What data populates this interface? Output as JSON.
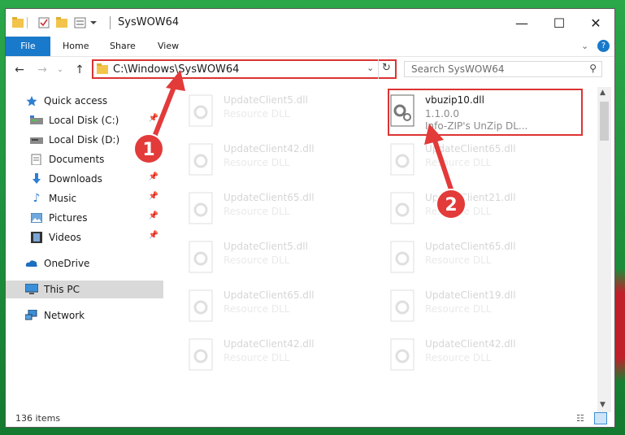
{
  "window": {
    "title": "SysWOW64",
    "controls": {
      "minimize": "—",
      "maximize": "☐",
      "close": "✕"
    }
  },
  "ribbon": {
    "tabs": [
      {
        "label": "File"
      },
      {
        "label": "Home"
      },
      {
        "label": "Share"
      },
      {
        "label": "View"
      }
    ],
    "help": "?"
  },
  "address": {
    "path": "C:\\Windows\\SysWOW64",
    "search_placeholder": "Search SysWOW64"
  },
  "sidebar": {
    "items": [
      {
        "label": "Quick access",
        "icon": "star-icon",
        "pinned": false
      },
      {
        "label": "Local Disk (C:)",
        "icon": "drive-icon",
        "pinned": true
      },
      {
        "label": "Local Disk (D:)",
        "icon": "drive-icon",
        "pinned": true
      },
      {
        "label": "Documents",
        "icon": "documents-icon",
        "pinned": true
      },
      {
        "label": "Downloads",
        "icon": "download-icon",
        "pinned": true
      },
      {
        "label": "Music",
        "icon": "music-icon",
        "pinned": true
      },
      {
        "label": "Pictures",
        "icon": "pictures-icon",
        "pinned": true
      },
      {
        "label": "Videos",
        "icon": "videos-icon",
        "pinned": true
      },
      {
        "label": "OneDrive",
        "icon": "cloud-icon",
        "pinned": false
      },
      {
        "label": "This PC",
        "icon": "pc-icon",
        "pinned": false,
        "selected": true
      },
      {
        "label": "Network",
        "icon": "network-icon",
        "pinned": false
      }
    ]
  },
  "files": {
    "highlighted": {
      "name": "vbuzip10.dll",
      "version": "1.1.0.0",
      "description": "Info-ZIP's UnZip DL..."
    },
    "left_column": [
      {
        "name": "UpdateClient5.dll",
        "type": "Resource DLL"
      },
      {
        "name": "UpdateClient42.dll",
        "type": "Resource DLL"
      },
      {
        "name": "UpdateClient65.dll",
        "type": "Resource DLL"
      },
      {
        "name": "UpdateClient5.dll",
        "type": "Resource DLL"
      },
      {
        "name": "UpdateClient65.dll",
        "type": "Resource DLL"
      },
      {
        "name": "UpdateClient42.dll",
        "type": "Resource DLL"
      }
    ],
    "right_column": [
      {
        "name": "UpdateClient65.dll",
        "type": "Resource DLL"
      },
      {
        "name": "UpdateClient21.dll",
        "type": "Resource DLL"
      },
      {
        "name": "UpdateClient65.dll",
        "type": "Resource DLL"
      },
      {
        "name": "UpdateClient19.dll",
        "type": "Resource DLL"
      },
      {
        "name": "UpdateClient42.dll",
        "type": "Resource DLL"
      }
    ]
  },
  "status": {
    "item_count": "136 items"
  },
  "callouts": {
    "one": "1",
    "two": "2"
  },
  "colors": {
    "accent": "#1979ca",
    "highlight": "#dd3333",
    "callout": "#e33a3a"
  }
}
